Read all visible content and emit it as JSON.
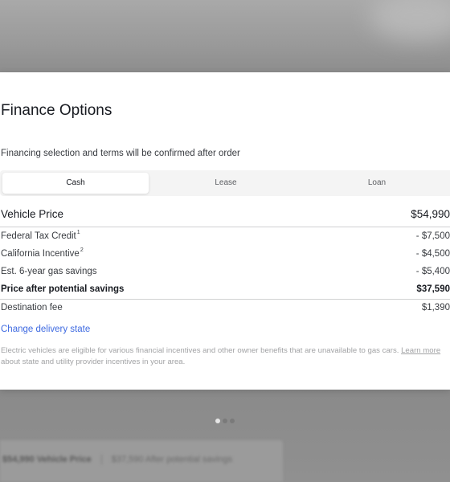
{
  "modal": {
    "title": "Finance Options",
    "subtitle": "Financing selection and terms will be confirmed after order",
    "tabs": [
      {
        "label": "Cash",
        "active": true
      },
      {
        "label": "Lease",
        "active": false
      },
      {
        "label": "Loan",
        "active": false
      }
    ],
    "vehicle_price": {
      "label": "Vehicle Price",
      "value": "$54,990"
    },
    "federal_tax_credit": {
      "label": "Federal Tax Credit",
      "footnote": "1",
      "value": "- $7,500"
    },
    "california_incentive": {
      "label": "California Incentive",
      "footnote": "2",
      "value": "- $4,500"
    },
    "gas_savings": {
      "label": "Est. 6-year gas savings",
      "value": "- $5,400"
    },
    "price_after_savings": {
      "label": "Price after potential savings",
      "value": "$37,590"
    },
    "destination_fee": {
      "label": "Destination fee",
      "value": "$1,390"
    },
    "change_delivery_state": "Change delivery state",
    "disclaimer": {
      "text_before": "Electric vehicles are eligible for various financial incentives and other owner benefits that are unavailable to gas cars.",
      "link": "Learn more",
      "text_after": "about state and utility provider incentives in your area."
    }
  },
  "carousel": {
    "count": 3,
    "active_index": 0
  },
  "background_bar": {
    "vehicle_price": "$54,990 Vehicle Price",
    "after_savings": "$37,590 After potential savings"
  },
  "colors": {
    "link": "#3e6ae1",
    "text_primary": "#171a20",
    "text_secondary": "#393c41",
    "tab_track": "#f4f4f4"
  }
}
